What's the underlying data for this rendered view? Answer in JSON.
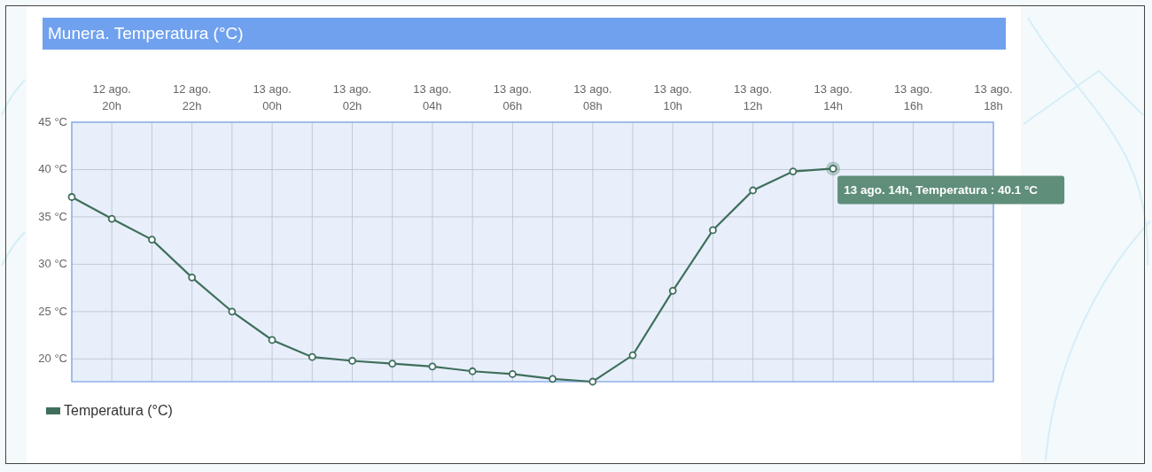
{
  "panel": {
    "title": "Munera. Temperatura (°C)"
  },
  "chart_data": {
    "type": "line",
    "categories": [
      null,
      "12 ago.\n20h",
      null,
      "12 ago.\n22h",
      null,
      "13 ago.\n00h",
      null,
      "13 ago.\n02h",
      null,
      "13 ago.\n04h",
      null,
      "13 ago.\n06h",
      null,
      "13 ago.\n08h",
      null,
      "13 ago.\n10h",
      null,
      "13 ago.\n12h",
      null,
      "13 ago.\n14h",
      null,
      "13 ago.\n16h",
      null,
      "13 ago.\n18h"
    ],
    "grid": true,
    "series": [
      {
        "name": "Temperatura (°C)",
        "color": "#3f6f5c",
        "marker": "o",
        "values": [
          37.1,
          34.8,
          32.6,
          28.6,
          25.0,
          22.0,
          20.2,
          19.8,
          19.5,
          19.2,
          18.7,
          18.4,
          17.9,
          17.6,
          20.4,
          27.2,
          33.6,
          37.8,
          39.8,
          40.1,
          null,
          null,
          null,
          null
        ]
      }
    ],
    "ylim": [
      17.6,
      45
    ],
    "yticks": [
      {
        "value": 20,
        "label": "20 °C"
      },
      {
        "value": 25,
        "label": "25 °C"
      },
      {
        "value": 30,
        "label": "30 °C"
      },
      {
        "value": 35,
        "label": "35 °C"
      },
      {
        "value": 40,
        "label": "40 °C"
      },
      {
        "value": 45,
        "label": "45 °C"
      }
    ],
    "annotations": [
      {
        "x": "13 ago.\n14h",
        "y": 40.1,
        "text": "13 ago. 14h, Temperatura : 40.1 °C"
      }
    ]
  }
}
